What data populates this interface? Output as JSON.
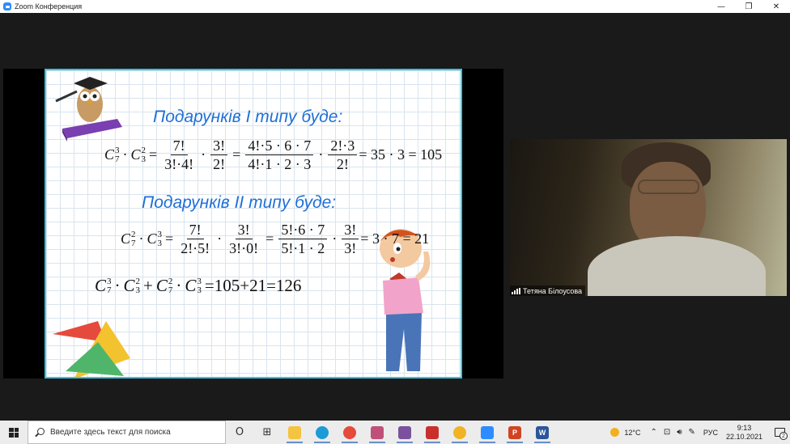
{
  "window": {
    "title": "Zoom Конференция",
    "controls": {
      "minimize": "—",
      "restore": "❐",
      "close": "✕"
    }
  },
  "slide": {
    "heading1": "Подарунків І типу буде:",
    "heading2": "Подарунків ІІ типу буде:",
    "formula1": {
      "f1_num": "7!",
      "f1_den": "3!·4!",
      "f2_num": "3!",
      "f2_den": "2!",
      "f3_num": "4!·5 · 6 · 7",
      "f3_den": "4!·1 · 2 · 3",
      "f4_num": "2!·3",
      "f4_den": "2!",
      "result": "= 35 · 3 = 105"
    },
    "formula2": {
      "f1_num": "7!",
      "f1_den": "2!·5!",
      "f2_num": "3!",
      "f2_den": "3!·0!",
      "f3_num": "5!·6 · 7",
      "f3_den": "5!·1 · 2",
      "f4_num": "3!",
      "f4_den": "3!",
      "result": "= 3 · 7 = 21"
    },
    "formula3": {
      "result": "=105+21=126"
    }
  },
  "participant": {
    "name": "Тетяна Білоусова"
  },
  "taskbar": {
    "search_placeholder": "Введите здесь текст для поиска",
    "weather": "12°C",
    "tray_chevron": "⌃",
    "language": "РУС",
    "time": "9:13",
    "date": "22.10.2021",
    "notification_count": "2",
    "apps": [
      {
        "name": "task-view",
        "color": "#333333",
        "glyph": "O"
      },
      {
        "name": "widgets",
        "color": "#333333",
        "glyph": "⊞"
      },
      {
        "name": "file-explorer",
        "color": "#f4c441",
        "glyph": ""
      },
      {
        "name": "edge",
        "color": "#1d9bd7",
        "glyph": ""
      },
      {
        "name": "chrome",
        "color": "#e64a3a",
        "glyph": ""
      },
      {
        "name": "paint",
        "color": "#c0507a",
        "glyph": ""
      },
      {
        "name": "viber",
        "color": "#7b519d",
        "glyph": ""
      },
      {
        "name": "app-red",
        "color": "#c9302c",
        "glyph": ""
      },
      {
        "name": "app-yellow",
        "color": "#f0b323",
        "glyph": ""
      },
      {
        "name": "zoom",
        "color": "#2d8cff",
        "glyph": ""
      },
      {
        "name": "powerpoint",
        "color": "#d04423",
        "glyph": "P"
      },
      {
        "name": "word",
        "color": "#2b579a",
        "glyph": "W"
      }
    ]
  },
  "colors": {
    "heading": "#1e6fd8",
    "slide_border": "#36c6e2",
    "meeting_bg": "#1a1a1a"
  }
}
